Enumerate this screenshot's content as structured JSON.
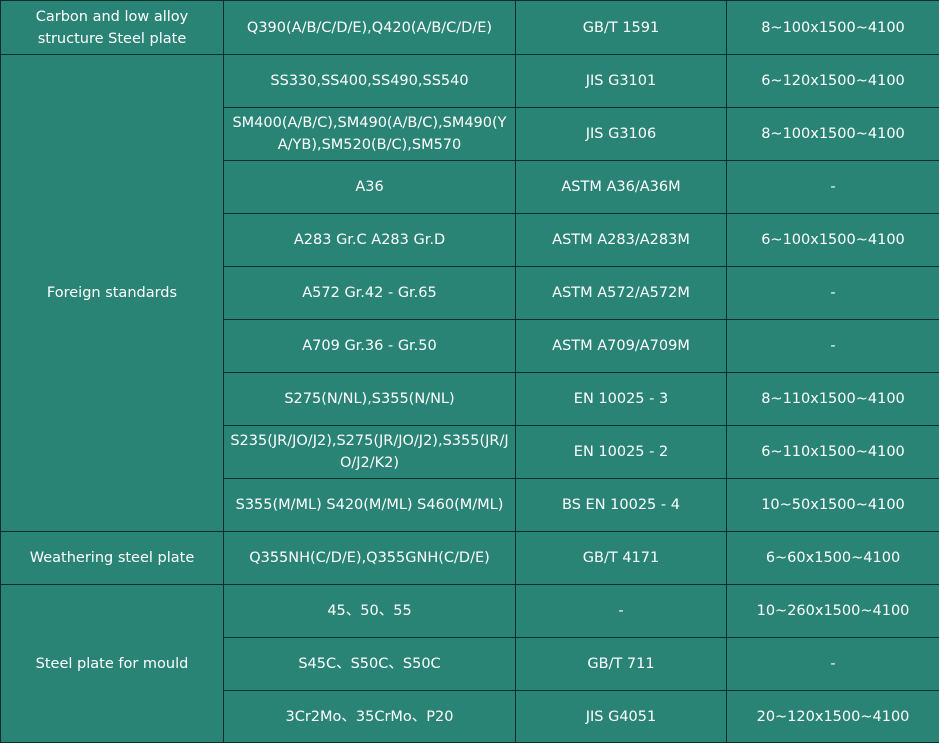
{
  "table": {
    "groups": [
      {
        "category": "Carbon and low alloy structure Steel plate",
        "rows": [
          {
            "grade": "Q390(A/B/C/D/E),Q420(A/B/C/D/E)",
            "standard": "GB/T 1591",
            "size": "8~100x1500~4100"
          }
        ]
      },
      {
        "category": "Foreign standards",
        "rows": [
          {
            "grade": "SS330,SS400,SS490,SS540",
            "standard": "JIS G3101",
            "size": "6~120x1500~4100"
          },
          {
            "grade": "SM400(A/B/C),SM490(A/B/C),SM490(YA/YB),SM520(B/C),SM570",
            "standard": "JIS G3106",
            "size": "8~100x1500~4100"
          },
          {
            "grade": "A36",
            "standard": "ASTM A36/A36M",
            "size": "-"
          },
          {
            "grade": "A283 Gr.C A283 Gr.D",
            "standard": "ASTM A283/A283M",
            "size": "6~100x1500~4100"
          },
          {
            "grade": "A572 Gr.42 - Gr.65",
            "standard": "ASTM A572/A572M",
            "size": "-"
          },
          {
            "grade": "A709 Gr.36 - Gr.50",
            "standard": "ASTM A709/A709M",
            "size": "-"
          },
          {
            "grade": "S275(N/NL),S355(N/NL)",
            "standard": "EN 10025 - 3",
            "size": "8~110x1500~4100"
          },
          {
            "grade": "S235(JR/JO/J2),S275(JR/JO/J2),S355(JR/JO/J2/K2)",
            "standard": "EN 10025 - 2",
            "size": "6~110x1500~4100"
          },
          {
            "grade": "S355(M/ML) S420(M/ML) S460(M/ML)",
            "standard": "BS EN 10025 - 4",
            "size": "10~50x1500~4100"
          }
        ]
      },
      {
        "category": "Weathering steel plate",
        "rows": [
          {
            "grade": "Q355NH(C/D/E),Q355GNH(C/D/E)",
            "standard": "GB/T 4171",
            "size": "6~60x1500~4100"
          }
        ]
      },
      {
        "category": "Steel plate for mould",
        "rows": [
          {
            "grade": "45、50、55",
            "standard": "-",
            "size": "10~260x1500~4100"
          },
          {
            "grade": "S45C、S50C、S50C",
            "standard": "GB/T 711",
            "size": "-"
          },
          {
            "grade": "3Cr2Mo、35CrMo、P20",
            "standard": "JIS G4051",
            "size": "20~120x1500~4100"
          }
        ]
      }
    ]
  }
}
